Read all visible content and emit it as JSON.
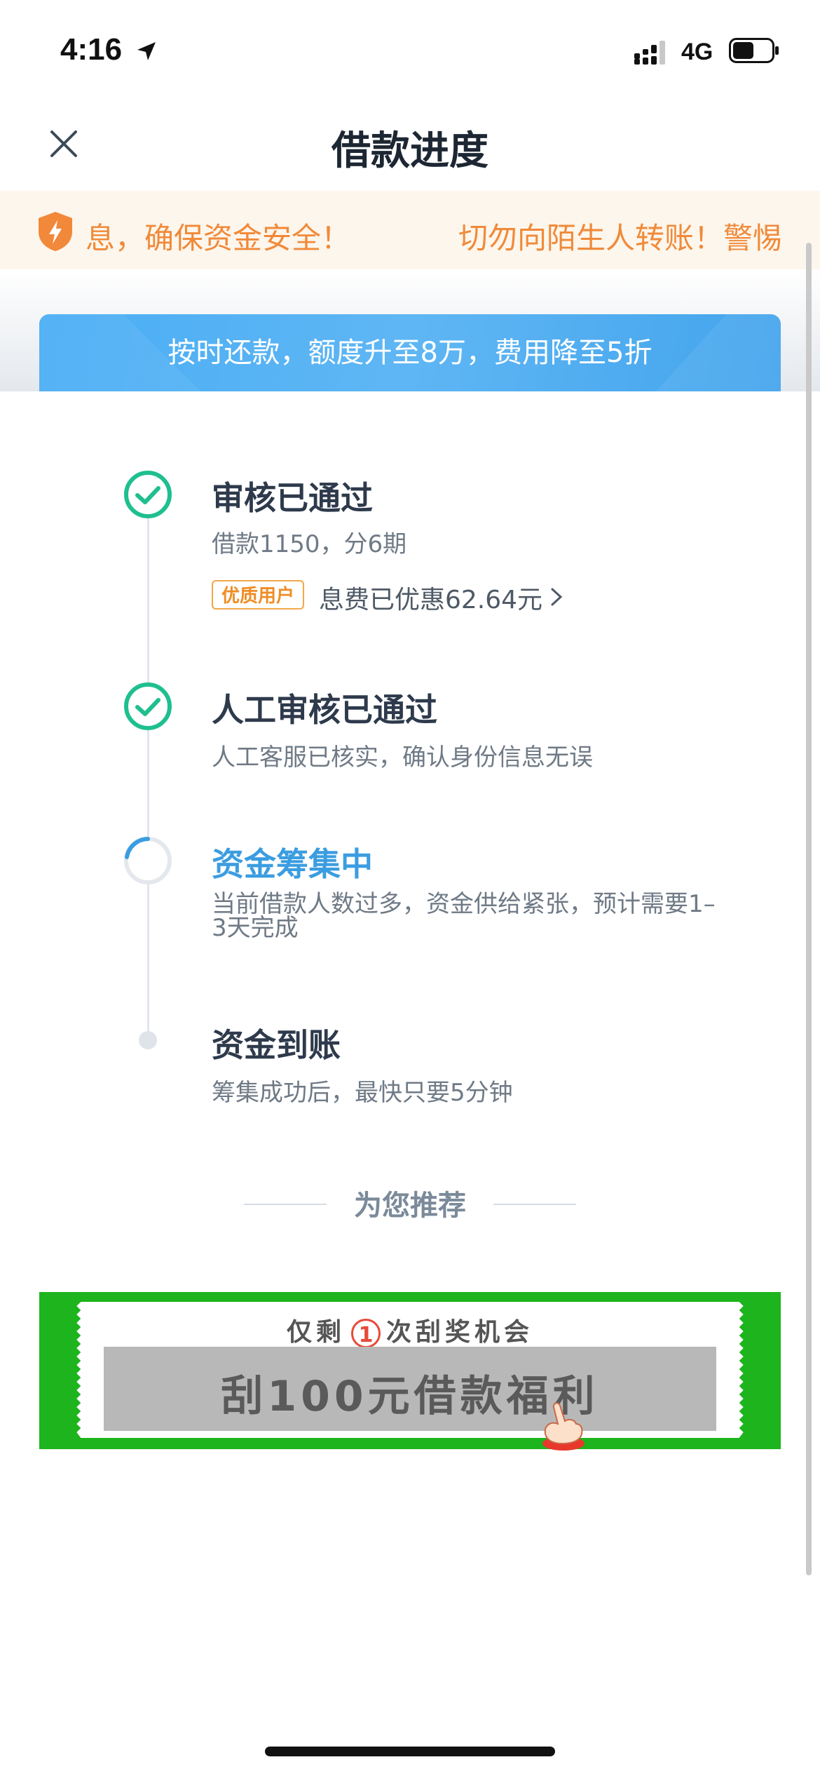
{
  "status_bar": {
    "time": "4:16",
    "network": "4G",
    "battery_level": 0.55
  },
  "nav": {
    "title": "借款进度"
  },
  "notice": {
    "text_left": "息，确保资金安全！",
    "text_right": "切勿向陌生人转账！警惕"
  },
  "promo": {
    "text": "按时还款，额度升至8万，费用降至5折"
  },
  "steps": [
    {
      "title": "审核已通过",
      "desc": "借款1150，分6期",
      "status": "done",
      "badge": "优质用户",
      "discount": "息费已优惠62.64元"
    },
    {
      "title": "人工审核已通过",
      "desc": "人工客服已核实，确认身份信息无误",
      "status": "done"
    },
    {
      "title": "资金筹集中",
      "desc_line1": "当前借款人数过多，资金供给紧张，预计需要1–",
      "desc_line2": "3天完成",
      "status": "in-progress"
    },
    {
      "title": "资金到账",
      "desc": "筹集成功后，最快只要5分钟",
      "status": "pending"
    }
  ],
  "recommend": {
    "label": "为您推荐"
  },
  "scratch_banner": {
    "top_prefix": "仅剩",
    "count": "1",
    "top_suffix": "次刮奖机会",
    "main_text": "刮100元借款福利"
  },
  "colors": {
    "accent": "#3b9de0",
    "success": "#1fbf8f",
    "warning": "#f08a3a",
    "banner_green": "#1db41d"
  }
}
